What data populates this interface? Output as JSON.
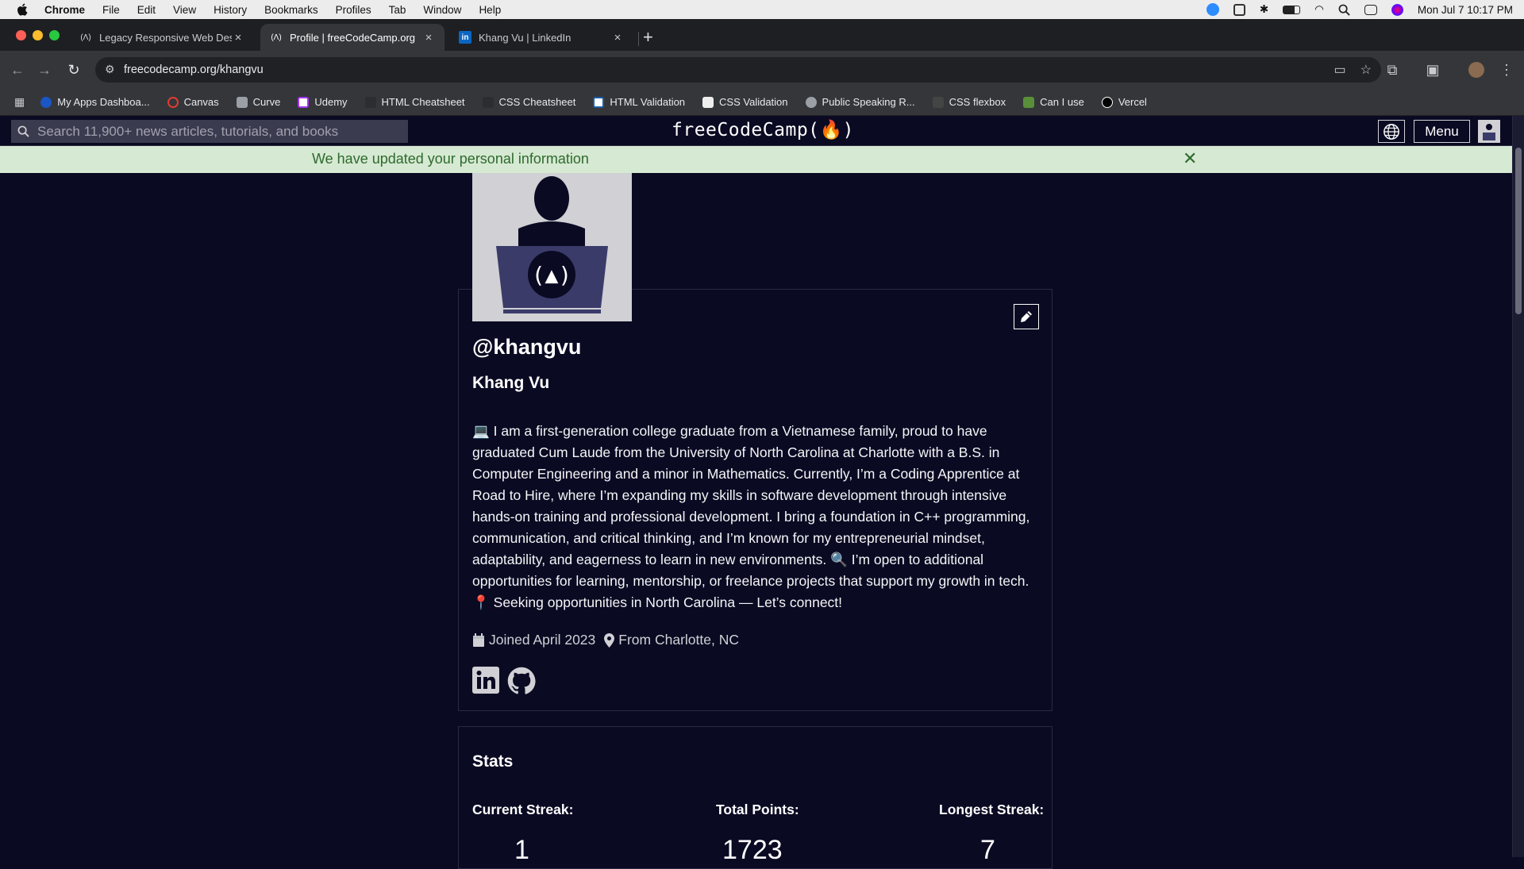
{
  "mac_menu": {
    "app": "Chrome",
    "items": [
      "File",
      "Edit",
      "View",
      "History",
      "Bookmarks",
      "Profiles",
      "Tab",
      "Window",
      "Help"
    ],
    "clock": "Mon Jul 7  10:17 PM"
  },
  "tabs": [
    {
      "title": "Legacy Responsive Web Desi",
      "favicon": "fcc-icon",
      "active": false
    },
    {
      "title": "Profile | freeCodeCamp.org",
      "favicon": "fcc-icon",
      "active": true
    },
    {
      "title": "Khang Vu | LinkedIn",
      "favicon": "linkedin-icon",
      "active": false
    }
  ],
  "address": {
    "url": "freecodecamp.org/khangvu"
  },
  "bookmarks": [
    {
      "label": "My Apps Dashboa...",
      "color": "#1a56c4"
    },
    {
      "label": "Canvas",
      "color": "#e03c31"
    },
    {
      "label": "Curve",
      "color": "#9aa0a6"
    },
    {
      "label": "Udemy",
      "color": "#a435f0"
    },
    {
      "label": "HTML Cheatsheet",
      "color": "#2b2d31"
    },
    {
      "label": "CSS Cheatsheet",
      "color": "#2b2d31"
    },
    {
      "label": "HTML Validation",
      "color": "#1b5fa8"
    },
    {
      "label": "CSS Validation",
      "color": "#111111"
    },
    {
      "label": "Public Speaking R...",
      "color": "#9aa0a6"
    },
    {
      "label": "CSS flexbox",
      "color": "#444444"
    },
    {
      "label": "Can I use",
      "color": "#5a8f3a"
    },
    {
      "label": "Vercel",
      "color": "#000000"
    }
  ],
  "fcc_nav": {
    "search_placeholder": "Search 11,900+ news articles, tutorials, and books",
    "logo": "freeCodeCamp(🔥)",
    "menu_label": "Menu"
  },
  "flash": {
    "message": "We have updated your personal information",
    "close": "✕"
  },
  "profile": {
    "username": "@khangvu",
    "name": "Khang Vu",
    "bio": "💻 I am a first-generation college graduate from a Vietnamese family, proud to have graduated Cum Laude from the University of North Carolina at Charlotte with a B.S. in Computer Engineering and a minor in Mathematics. Currently, I’m a Coding Apprentice at Road to Hire, where I’m expanding my skills in software development through intensive hands-on training and professional development. I bring a foundation in C++ programming, communication, and critical thinking, and I’m known for my entrepreneurial mindset, adaptability, and eagerness to learn in new environments. 🔍 I’m open to additional opportunities for learning, mentorship, or freelance projects that support my growth in tech. 📍 Seeking opportunities in North Carolina — Let’s connect!",
    "joined": "Joined April 2023",
    "location": "From Charlotte, NC"
  },
  "stats": {
    "title": "Stats",
    "current_streak_label": "Current Streak:",
    "current_streak": "1",
    "total_points_label": "Total Points:",
    "total_points": "1723",
    "longest_streak_label": "Longest Streak:",
    "longest_streak": "7"
  }
}
